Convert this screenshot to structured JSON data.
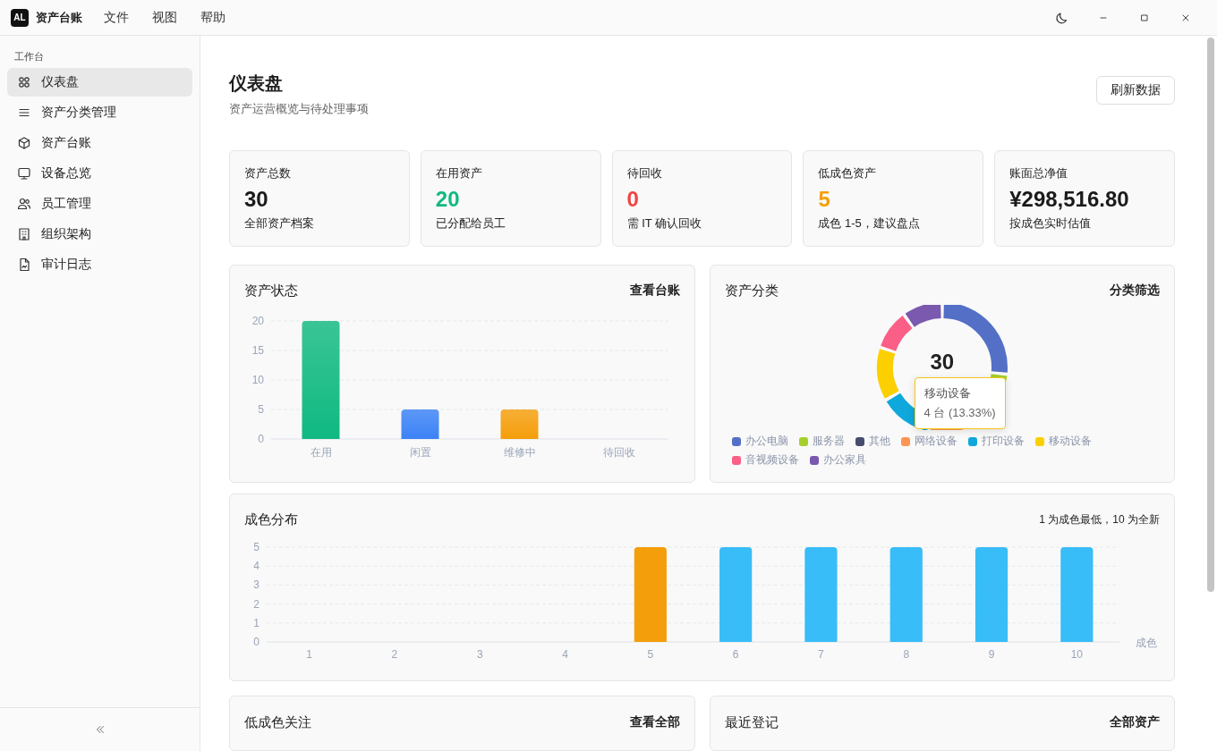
{
  "titlebar": {
    "logo": "AL",
    "app_name": "资产台账",
    "menus": [
      "文件",
      "视图",
      "帮助"
    ]
  },
  "sidebar": {
    "section": "工作台",
    "items": [
      {
        "label": "仪表盘",
        "selected": true
      },
      {
        "label": "资产分类管理",
        "selected": false
      },
      {
        "label": "资产台账",
        "selected": false
      },
      {
        "label": "设备总览",
        "selected": false
      },
      {
        "label": "员工管理",
        "selected": false
      },
      {
        "label": "组织架构",
        "selected": false
      },
      {
        "label": "审计日志",
        "selected": false
      }
    ]
  },
  "page": {
    "title": "仪表盘",
    "subtitle": "资产运营概览与待处理事项",
    "refresh_button": "刷新数据"
  },
  "kpis": [
    {
      "label": "资产总数",
      "value": "30",
      "note": "全部资产档案",
      "color": "#1a1a1a"
    },
    {
      "label": "在用资产",
      "value": "20",
      "note": "已分配给员工",
      "color": "#10b981"
    },
    {
      "label": "待回收",
      "value": "0",
      "note": "需 IT 确认回收",
      "color": "#ef4444"
    },
    {
      "label": "低成色资产",
      "value": "5",
      "note": "成色 1-5，建议盘点",
      "color": "#f59e0b"
    },
    {
      "label": "账面总净值",
      "value": "¥298,516.80",
      "note": "按成色实时估值",
      "color": "#1a1a1a"
    }
  ],
  "status_panel": {
    "title": "资产状态",
    "link": "查看台账",
    "chart_data": {
      "type": "bar",
      "categories": [
        "在用",
        "闲置",
        "维修中",
        "待回收"
      ],
      "values": [
        20,
        5,
        5,
        0
      ],
      "colors": [
        "#10b981",
        "#3b82f6",
        "#f59e0b",
        null
      ],
      "grid": true,
      "ylim": [
        0,
        20
      ],
      "yticks": [
        0,
        5,
        10,
        15,
        20
      ]
    }
  },
  "category_panel": {
    "title": "资产分类",
    "link": "分类筛选",
    "center_value": "30",
    "legend": [
      {
        "label": "办公电脑",
        "color": "#5470c6"
      },
      {
        "label": "服务器",
        "color": "#a5d02a"
      },
      {
        "label": "其他",
        "color": "#474c6e"
      },
      {
        "label": "网络设备",
        "color": "#fc9551"
      },
      {
        "label": "打印设备",
        "color": "#0fa8dc"
      },
      {
        "label": "移动设备",
        "color": "#fcd000"
      },
      {
        "label": "音视频设备",
        "color": "#fb5e87"
      },
      {
        "label": "办公家具",
        "color": "#7a59ae"
      }
    ],
    "tooltip": {
      "title": "移动设备",
      "text": "4 台 (13.33%)"
    }
  },
  "condition_panel": {
    "title": "成色分布",
    "note": "1 为成色最低，10 为全新",
    "chart_data": {
      "type": "bar",
      "xlabel": "成色",
      "categories": [
        "1",
        "2",
        "3",
        "4",
        "5",
        "6",
        "7",
        "8",
        "9",
        "10"
      ],
      "values": [
        0,
        0,
        0,
        0,
        5,
        5,
        5,
        5,
        5,
        5
      ],
      "colors": [
        null,
        null,
        null,
        null,
        "#f59e0b",
        "#38bdf8",
        "#38bdf8",
        "#38bdf8",
        "#38bdf8",
        "#38bdf8"
      ],
      "grid": true,
      "ylim": [
        0,
        5
      ],
      "yticks": [
        0,
        1,
        2,
        3,
        4,
        5
      ]
    }
  },
  "bottom_panels": [
    {
      "title": "低成色关注",
      "link": "查看全部"
    },
    {
      "title": "最近登记",
      "link": "全部资产"
    }
  ]
}
